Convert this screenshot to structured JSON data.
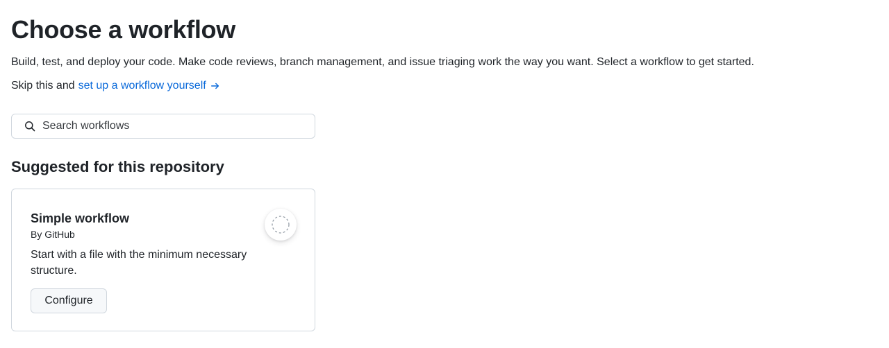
{
  "header": {
    "title": "Choose a workflow",
    "description": "Build, test, and deploy your code. Make code reviews, branch management, and issue triaging work the way you want. Select a workflow to get started.",
    "skip_prefix": "Skip this and",
    "skip_link": "set up a workflow yourself"
  },
  "search": {
    "placeholder": "Search workflows",
    "value": ""
  },
  "suggested": {
    "section_title": "Suggested for this repository",
    "cards": [
      {
        "title": "Simple workflow",
        "author": "By GitHub",
        "description": "Start with a file with the minimum necessary structure.",
        "button": "Configure",
        "icon": "workflow-placeholder-icon"
      }
    ]
  },
  "colors": {
    "text": "#1f2328",
    "link": "#0969da",
    "border": "#d0d7de",
    "button_bg": "#f6f8fa"
  }
}
